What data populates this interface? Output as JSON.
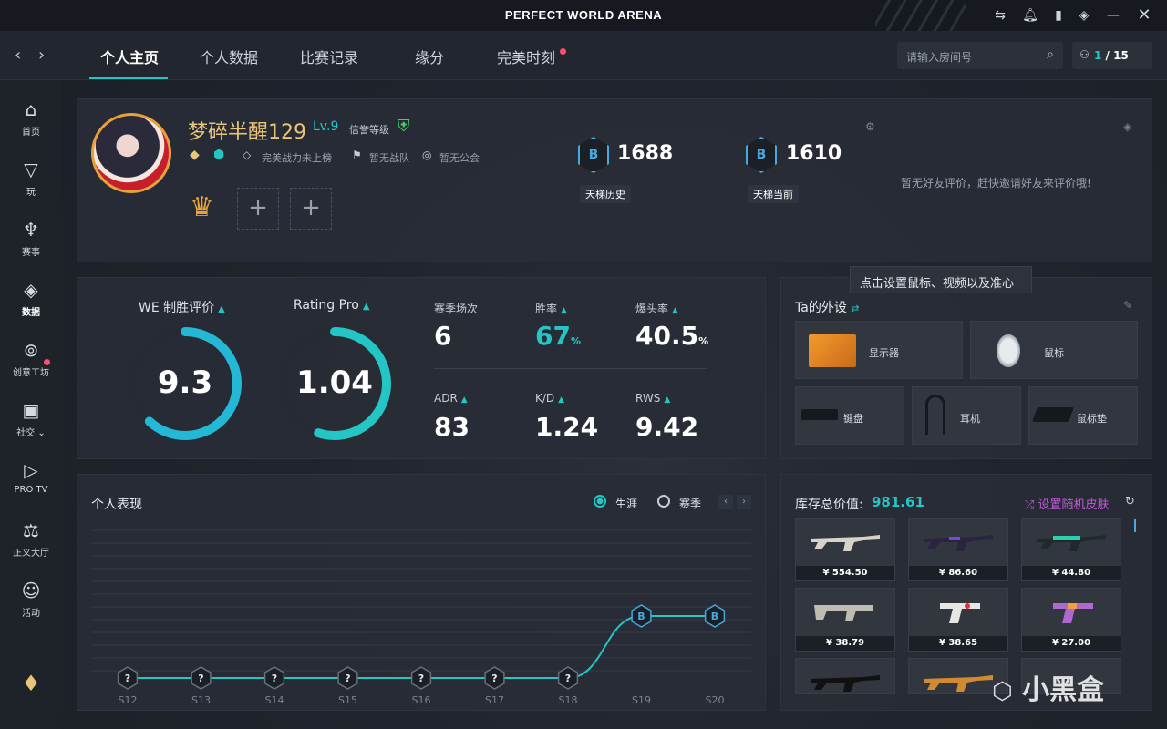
{
  "app": {
    "title": "PERFECT WORLD ARENA"
  },
  "nav": {
    "tabs": [
      {
        "label": "个人主页",
        "active": true
      },
      {
        "label": "个人数据"
      },
      {
        "label": "比赛记录"
      },
      {
        "label": "缘分"
      },
      {
        "label": "完美时刻",
        "dot": true
      }
    ],
    "search_placeholder": "请输入房间号",
    "queue": {
      "current": "1",
      "total": "/ 15"
    }
  },
  "sidebar": {
    "items": [
      {
        "label": "首页",
        "icon": "home-icon"
      },
      {
        "label": "玩",
        "icon": "play-icon"
      },
      {
        "label": "赛事",
        "icon": "trophy-icon"
      },
      {
        "label": "数据",
        "icon": "data-icon",
        "active": true,
        "dot": true
      },
      {
        "label": "创意工坊",
        "icon": "planet-icon"
      },
      {
        "label": "社交",
        "icon": "social-icon"
      },
      {
        "label": "PRO TV",
        "icon": "tv-icon"
      },
      {
        "label": "正义大厅",
        "icon": "scale-icon"
      },
      {
        "label": "活动",
        "icon": "activity-icon"
      }
    ]
  },
  "profile": {
    "username": "梦碎半醒129",
    "level": "Lv.9",
    "credit_label": "信誉等级",
    "power_rank": "完美战力未上榜",
    "team": "暂无战队",
    "guild": "暂无公会",
    "ladder_history": {
      "value": "1688",
      "label": "天梯历史"
    },
    "ladder_current": {
      "value": "1610",
      "label": "天梯当前"
    },
    "friend_review": "暂无好友评价，赶快邀请好友来评价哦!"
  },
  "stats": {
    "we_title": "WE 制胜评价",
    "we_value": "9.3",
    "we_fraction": 0.62,
    "rating_title": "Rating Pro",
    "rating_value": "1.04",
    "rating_fraction": 0.55,
    "season_matches": {
      "label": "赛季场次",
      "value": "6"
    },
    "win_rate": {
      "label": "胜率",
      "value": "67",
      "unit": "%"
    },
    "headshot": {
      "label": "爆头率",
      "value": "40.5",
      "unit": "%"
    },
    "adr": {
      "label": "ADR",
      "value": "83"
    },
    "kd": {
      "label": "K/D",
      "value": "1.24"
    },
    "rws": {
      "label": "RWS",
      "value": "9.42"
    }
  },
  "peripherals": {
    "tooltip": "点击设置鼠标、视频以及准心",
    "title": "Ta的外设",
    "items": [
      {
        "label": "显示器"
      },
      {
        "label": "鼠标"
      },
      {
        "label": "键盘"
      },
      {
        "label": "耳机"
      },
      {
        "label": "鼠标垫"
      }
    ]
  },
  "performance": {
    "title": "个人表现",
    "option_career": "生涯",
    "option_season": "赛季"
  },
  "chart_data": {
    "type": "line",
    "x": [
      "S12",
      "S13",
      "S14",
      "S15",
      "S16",
      "S17",
      "S18",
      "S19",
      "S20"
    ],
    "series": [
      {
        "values": [
          0,
          0,
          0,
          0,
          0,
          0,
          0,
          1,
          1
        ]
      }
    ],
    "point_badges": [
      "?",
      "?",
      "?",
      "?",
      "?",
      "?",
      "?",
      "B",
      "B"
    ],
    "grid": true,
    "accent": "#23c5c5"
  },
  "inventory": {
    "title": "库存总价值:",
    "total": "981.61",
    "random_skin": "设置随机皮肤",
    "items": [
      {
        "price": "¥ 554.50"
      },
      {
        "price": "¥ 86.60"
      },
      {
        "price": "¥ 44.80"
      },
      {
        "price": "¥ 38.79"
      },
      {
        "price": "¥ 38.65"
      },
      {
        "price": "¥ 27.00"
      }
    ]
  },
  "watermark": "小黑盒",
  "colors": {
    "accent": "#23c5c5",
    "gold": "#e8c57a",
    "alert": "#ff4d6d",
    "purple": "#c25ad8"
  }
}
